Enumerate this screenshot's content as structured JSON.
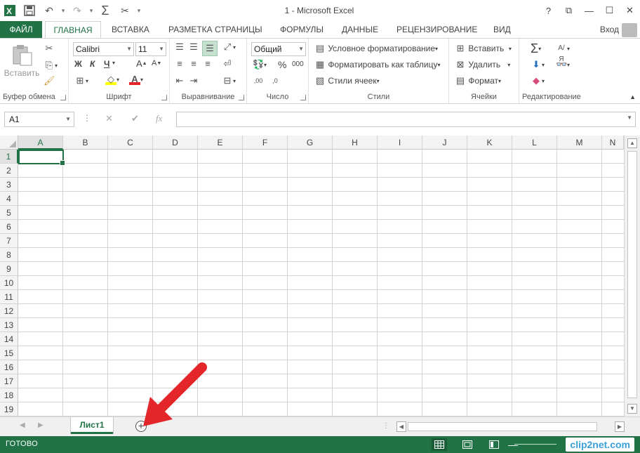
{
  "window": {
    "title": "1 - Microsoft Excel",
    "controls": [
      "?",
      "⧉",
      "—",
      "☐",
      "✕"
    ]
  },
  "qat": {
    "app_icon": "excel-logo-icon",
    "items": [
      "save-icon",
      "undo-icon",
      "redo-icon",
      "autosum-icon",
      "cut-icon"
    ]
  },
  "tabs": {
    "file": "ФАЙЛ",
    "home": "ГЛАВНАЯ",
    "insert": "ВСТАВКА",
    "page_layout": "РАЗМЕТКА СТРАНИЦЫ",
    "formulas": "ФОРМУЛЫ",
    "data": "ДАННЫЕ",
    "review": "РЕЦЕНЗИРОВАНИЕ",
    "view": "ВИД",
    "login": "Вход"
  },
  "ribbon": {
    "clipboard": {
      "label": "Буфер обмена",
      "paste": "Вставить"
    },
    "font": {
      "label": "Шрифт",
      "name": "Calibri",
      "size": "11",
      "bold": "Ж",
      "italic": "К",
      "underline": "Ч"
    },
    "alignment": {
      "label": "Выравнивание"
    },
    "number": {
      "label": "Число",
      "format": "Общий",
      "percent": "%",
      "thousands": "000"
    },
    "styles": {
      "label": "Стили",
      "conditional": "Условное форматирование",
      "format_table": "Форматировать как таблицу",
      "cell_styles": "Стили ячеек"
    },
    "cells": {
      "label": "Ячейки",
      "insert": "Вставить",
      "delete": "Удалить",
      "format": "Формат"
    },
    "editing": {
      "label": "Редактирование"
    }
  },
  "formula_bar": {
    "name_box": "A1",
    "fx": "fx",
    "value": ""
  },
  "grid": {
    "columns": [
      "A",
      "B",
      "C",
      "D",
      "E",
      "F",
      "G",
      "H",
      "I",
      "J",
      "K",
      "L",
      "M",
      "N"
    ],
    "rows": [
      "1",
      "2",
      "3",
      "4",
      "5",
      "6",
      "7",
      "8",
      "9",
      "10",
      "11",
      "12",
      "13",
      "14",
      "15",
      "16",
      "17",
      "18",
      "19"
    ],
    "active_cell": "A1"
  },
  "sheets": {
    "tabs": [
      "Лист1"
    ],
    "active": "Лист1"
  },
  "status": {
    "text": "ГОТОВО",
    "watermark": "clip2net.com"
  },
  "colors": {
    "accent": "#217346",
    "arrow": "#e3262a"
  }
}
